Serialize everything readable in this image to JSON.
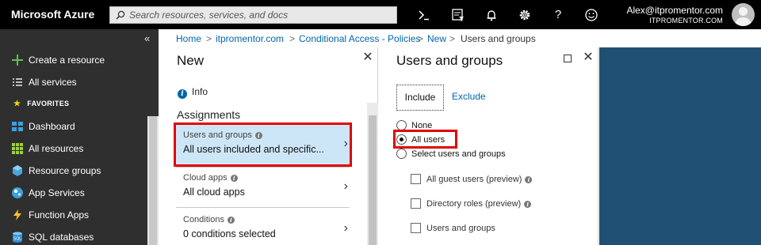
{
  "topbar": {
    "brand": "Microsoft Azure",
    "search_placeholder": "Search resources, services, and docs",
    "icons": [
      "cloud-shell-icon",
      "directory-filter-icon",
      "notifications-icon",
      "settings-icon",
      "help-icon",
      "feedback-icon"
    ],
    "user_email": "Alex@itpromentor.com",
    "user_tenant": "ITPROMENTOR.COM"
  },
  "leftnav": {
    "collapse_glyph": "«",
    "create": "Create a resource",
    "all_services": "All services",
    "favorites": "FAVORITES",
    "items": [
      {
        "label": "Dashboard",
        "icon": "dashboard-icon"
      },
      {
        "label": "All resources",
        "icon": "all-resources-icon"
      },
      {
        "label": "Resource groups",
        "icon": "resource-groups-icon"
      },
      {
        "label": "App Services",
        "icon": "app-services-icon"
      },
      {
        "label": "Function Apps",
        "icon": "function-apps-icon"
      },
      {
        "label": "SQL databases",
        "icon": "sql-databases-icon"
      }
    ]
  },
  "breadcrumb": {
    "items": [
      "Home",
      "itpromentor.com",
      "Conditional Access - Policies",
      "New",
      "Users and groups"
    ],
    "separator": ">"
  },
  "new_blade": {
    "title": "New",
    "info": "Info",
    "assignments": "Assignments",
    "conditions": [
      {
        "title": "Users and groups",
        "value": "All users included and specific..."
      },
      {
        "title": "Cloud apps",
        "value": "All cloud apps"
      },
      {
        "title": "Conditions",
        "value": "0 conditions selected"
      }
    ]
  },
  "ug_blade": {
    "title": "Users and groups",
    "tabs": {
      "include": "Include",
      "exclude": "Exclude"
    },
    "radios": [
      "None",
      "All users",
      "Select users and groups"
    ],
    "selected_radio": "All users",
    "checks": [
      "All guest users (preview)",
      "Directory roles (preview)",
      "Users and groups"
    ]
  },
  "colors": {
    "topbar": "#000000",
    "leftnav": "#2f2f2f",
    "link": "#0066a8",
    "highlight": "#cde6f7",
    "annotation": "#e30000",
    "background_panel": "#1f4f72"
  }
}
